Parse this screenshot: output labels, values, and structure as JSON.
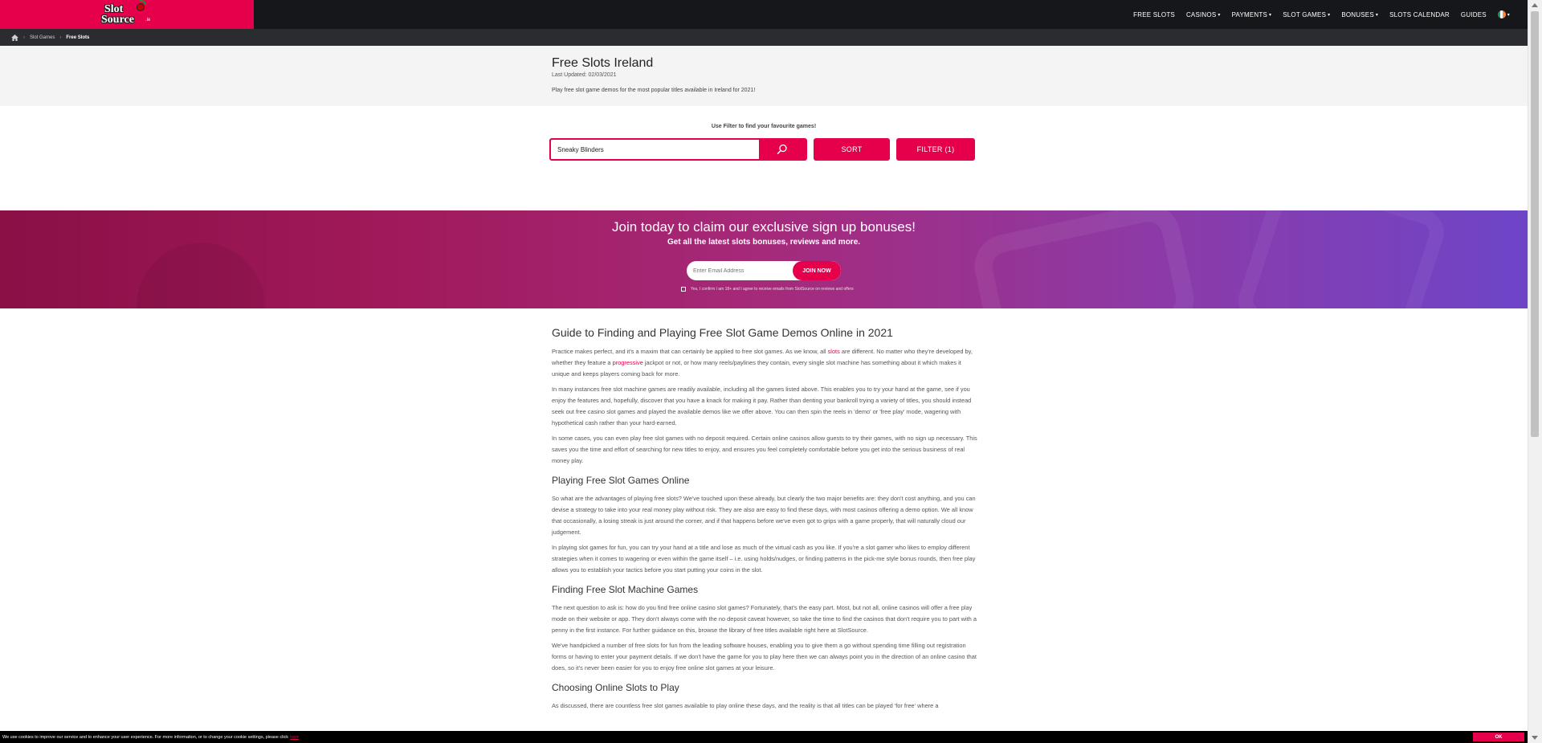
{
  "logo": {
    "line1": "Slot",
    "line2": "Source",
    "tld": ".ie"
  },
  "nav": {
    "items": [
      {
        "label": "FREE SLOTS",
        "dropdown": false
      },
      {
        "label": "CASINOS",
        "dropdown": true
      },
      {
        "label": "PAYMENTS",
        "dropdown": true
      },
      {
        "label": "SLOT GAMES",
        "dropdown": true
      },
      {
        "label": "BONUSES",
        "dropdown": true
      },
      {
        "label": "SLOTS CALENDAR",
        "dropdown": false
      },
      {
        "label": "GUIDES",
        "dropdown": false
      }
    ],
    "flag_colors": [
      "#169b62",
      "#ffffff",
      "#ff883e"
    ]
  },
  "breadcrumb": {
    "items": [
      "Slot Games",
      "Free Slots"
    ],
    "separator": "›"
  },
  "header": {
    "title": "Free Slots Ireland",
    "updated": "Last Updated: 02/03/2021",
    "intro": "Play free slot game demos for the most popular titles available in Ireland for 2021!"
  },
  "filter": {
    "caption": "Use Filter to find your favourite games!",
    "search_value": "Sneaky Blinders",
    "sort_label": "SORT",
    "filter_label": "FILTER (1)"
  },
  "promo": {
    "title": "Join today to claim our exclusive sign up bonuses!",
    "subtitle": "Get all the latest slots bonuses, reviews and more.",
    "email_placeholder": "Enter Email Address",
    "join_label": "JOIN NOW",
    "consent": "Yes, I confirm I am 18+ and I agree to receive emails from SlotSource on reviews and offers"
  },
  "article": {
    "h_main": "Guide to Finding and Playing Free Slot Game Demos Online in 2021",
    "p1_a": "Practice makes perfect, and it's a maxim that can certainly be applied to free slot games. As we know, all ",
    "p1_link1": "slots",
    "p1_b": " are different. No matter who they're developed by, whether they feature a ",
    "p1_link2": "progressive",
    "p1_c": " jackpot or not, or how many reels/paylines they contain, every single slot machine has something about it which makes it unique and keeps players coming back for more.",
    "p2": "In many instances free slot machine games are readily available, including all the games listed above. This enables you to try your hand at the game, see if you enjoy the features and, hopefully, discover that you have a knack for making it pay. Rather than denting your bankroll trying a variety of titles, you should instead seek out free casino slot games and played the available demos like we offer above. You can then spin the reels in 'demo' or 'free play' mode, wagering with hypothetical cash rather than your hard-earned.",
    "p3": "In some cases, you can even play free slot games with no deposit required. Certain online casinos allow guests to try their games, with no sign up necessary. This saves you the time and effort of searching for new titles to enjoy, and ensures you feel completely comfortable before you get into the serious business of real money play.",
    "h_playing": "Playing Free Slot Games Online",
    "p4": "So what are the advantages of playing free slots? We've touched upon these already, but clearly the two major benefits are: they don't cost anything, and you can devise a strategy to take into your real money play without risk. They are also are easy to find these days, with most casinos offering a demo option. We all know that occasionally, a losing streak is just around the corner, and if that happens before we've even got to grips with a game properly, that will naturally cloud our judgement.",
    "p5": "In playing slot games for fun, you can try your hand at a title and lose as much of the virtual cash as you like. If you're a slot gamer who likes to employ different strategies when it comes to wagering or even within the game itself – i.e. using holds/nudges, or finding patterns in the pick-me style bonus rounds, then free play allows you to establish your tactics before you start putting your coins in the slot.",
    "h_finding": "Finding Free Slot Machine Games",
    "p6": "The next question to ask is: how do you find free online casino slot games? Fortunately, that's the easy part. Most, but not all, online casinos will offer a free play mode on their website or app. They don't always come with the no deposit caveat however, so take the time to find the casinos that don't require you to part with a penny in the first instance. For further guidance on this, browse the library of free titles available right here at SlotSource.",
    "p7": "We've handpicked a number of free slots for fun from the leading software houses, enabling you to give them a go without spending time filling out registration forms or having to enter your payment details. If we don't have the game for you to play here then we can always point you in the direction of an online casino that does, so it's never been easier for you to enjoy free online slot games at your leisure.",
    "h_choosing": "Choosing Online Slots to Play",
    "p8": "As discussed, there are countless free slot games available to play online these days, and the reality is that all titles can be played 'for free' where a"
  },
  "cookie": {
    "text": "We use cookies to improve our service and to enhance your user experience. For more information, or to change your cookie settings, please click",
    "link": "here",
    "ok_label": "OK"
  },
  "colors": {
    "brand_pink": "#e6004c",
    "nav_bg": "#16171b",
    "crumb_bg": "#2b2c30"
  }
}
